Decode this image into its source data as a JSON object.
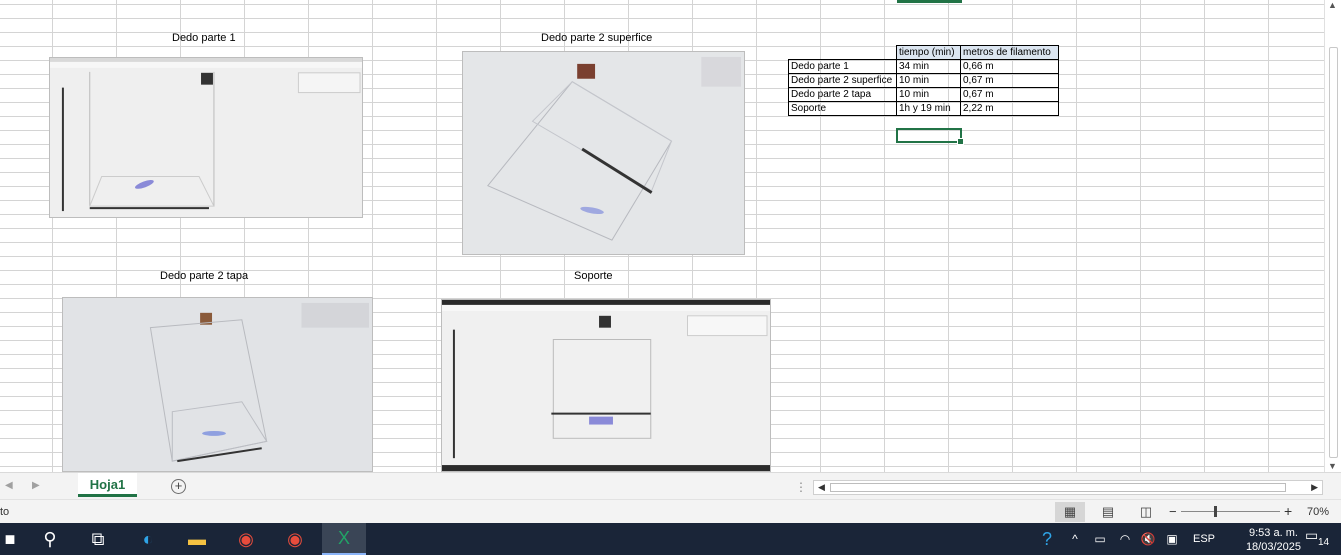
{
  "captions": {
    "img1": "Dedo parte 1",
    "img2": "Dedo parte 2 superfice",
    "img3": "Dedo parte 2 tapa",
    "img4": "Soporte"
  },
  "table": {
    "headers": [
      "tiempo (min)",
      "metros de filamento"
    ],
    "rows": [
      [
        "Dedo parte 1",
        "34 min",
        "0,66 m"
      ],
      [
        "Dedo parte 2 superfice",
        "10 min",
        "0,67 m"
      ],
      [
        "Dedo parte 2 tapa",
        "10 min",
        "0,67 m"
      ],
      [
        "Soporte",
        "1h y 19 min",
        "2,22 m"
      ]
    ]
  },
  "sheet_tab": "Hoja1",
  "status": {
    "text": "to",
    "zoom": "70%"
  },
  "taskbar": {
    "language": "ESP",
    "time": "9:53 a. m.",
    "date": "18/03/2025",
    "notification_count": "14"
  },
  "colors": {
    "accent": "#217346",
    "header_fill": "#dce6f1",
    "taskbar": "#1a2538"
  }
}
